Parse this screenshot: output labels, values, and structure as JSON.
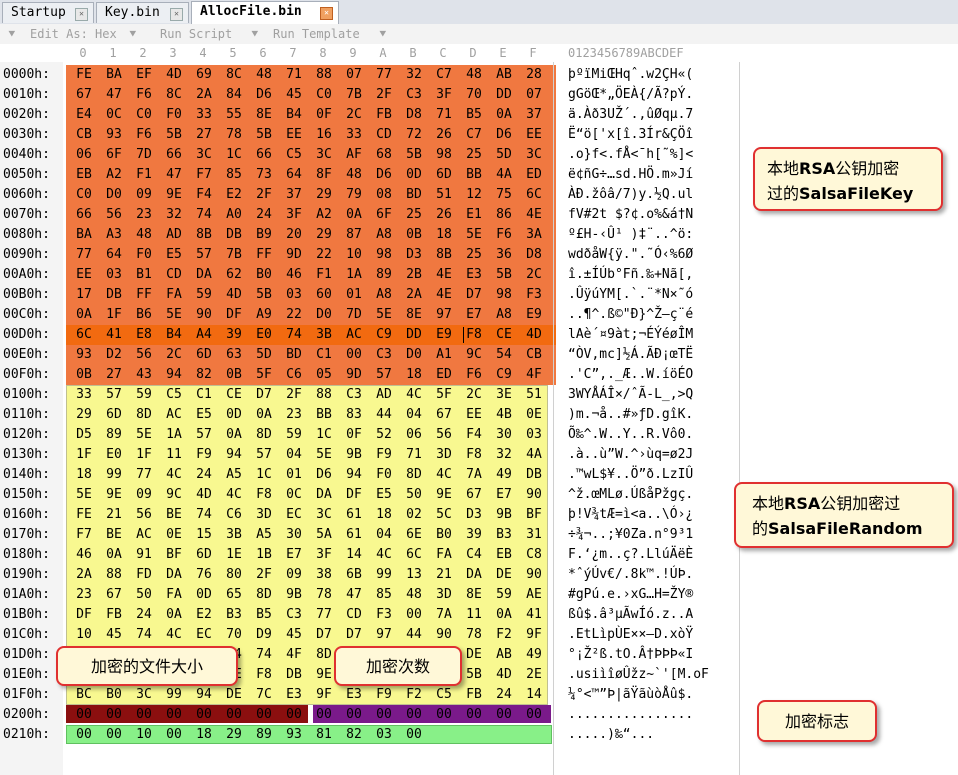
{
  "tabs": [
    {
      "label": "Startup",
      "active": false
    },
    {
      "label": "Key.bin",
      "active": false
    },
    {
      "label": "AllocFile.bin",
      "active": true
    }
  ],
  "toolbar": {
    "edit_as": "Edit As: Hex",
    "run_script": "Run Script",
    "run_template": "Run Template"
  },
  "hex_columns": [
    "0",
    "1",
    "2",
    "3",
    "4",
    "5",
    "6",
    "7",
    "8",
    "9",
    "A",
    "B",
    "C",
    "D",
    "E",
    "F"
  ],
  "ascii_header": "0123456789ABCDEF",
  "rows": [
    {
      "offset": "0000h:",
      "bytes": [
        "FE",
        "BA",
        "EF",
        "4D",
        "69",
        "8C",
        "48",
        "71",
        "88",
        "07",
        "77",
        "32",
        "C7",
        "48",
        "AB",
        "28"
      ],
      "ascii": "þºïMiŒHqˆ.w2ÇH«("
    },
    {
      "offset": "0010h:",
      "bytes": [
        "67",
        "47",
        "F6",
        "8C",
        "2A",
        "84",
        "D6",
        "45",
        "C0",
        "7B",
        "2F",
        "C3",
        "3F",
        "70",
        "DD",
        "07"
      ],
      "ascii": "gGöŒ*„ÖEÀ{/Ã?pÝ."
    },
    {
      "offset": "0020h:",
      "bytes": [
        "E4",
        "0C",
        "C0",
        "F0",
        "33",
        "55",
        "8E",
        "B4",
        "0F",
        "2C",
        "FB",
        "D8",
        "71",
        "B5",
        "0A",
        "37"
      ],
      "ascii": "ä.Àð3UŽ´.,ûØqµ.7"
    },
    {
      "offset": "0030h:",
      "bytes": [
        "CB",
        "93",
        "F6",
        "5B",
        "27",
        "78",
        "5B",
        "EE",
        "16",
        "33",
        "CD",
        "72",
        "26",
        "C7",
        "D6",
        "EE"
      ],
      "ascii": "Ë“ö['x[î.3Ír&ÇÖî"
    },
    {
      "offset": "0040h:",
      "bytes": [
        "06",
        "6F",
        "7D",
        "66",
        "3C",
        "1C",
        "66",
        "C5",
        "3C",
        "AF",
        "68",
        "5B",
        "98",
        "25",
        "5D",
        "3C"
      ],
      "ascii": ".o}f<.fÅ<¯h[˜%]<"
    },
    {
      "offset": "0050h:",
      "bytes": [
        "EB",
        "A2",
        "F1",
        "47",
        "F7",
        "85",
        "73",
        "64",
        "8F",
        "48",
        "D6",
        "0D",
        "6D",
        "BB",
        "4A",
        "ED"
      ],
      "ascii": "ë¢ñG÷…sd.HÖ.m»Jí"
    },
    {
      "offset": "0060h:",
      "bytes": [
        "C0",
        "D0",
        "09",
        "9E",
        "F4",
        "E2",
        "2F",
        "37",
        "29",
        "79",
        "08",
        "BD",
        "51",
        "12",
        "75",
        "6C"
      ],
      "ascii": "ÀÐ.žôâ/7)y.½Q.ul"
    },
    {
      "offset": "0070h:",
      "bytes": [
        "66",
        "56",
        "23",
        "32",
        "74",
        "A0",
        "24",
        "3F",
        "A2",
        "0A",
        "6F",
        "25",
        "26",
        "E1",
        "86",
        "4E"
      ],
      "ascii": "fV#2t $?¢.o%&á†N"
    },
    {
      "offset": "0080h:",
      "bytes": [
        "BA",
        "A3",
        "48",
        "AD",
        "8B",
        "DB",
        "B9",
        "20",
        "29",
        "87",
        "A8",
        "0B",
        "18",
        "5E",
        "F6",
        "3A"
      ],
      "ascii": "º£H-‹Û¹ )‡¨..^ö:"
    },
    {
      "offset": "0090h:",
      "bytes": [
        "77",
        "64",
        "F0",
        "E5",
        "57",
        "7B",
        "FF",
        "9D",
        "22",
        "10",
        "98",
        "D3",
        "8B",
        "25",
        "36",
        "D8"
      ],
      "ascii": "wdðåW{ÿ.\".˜Ó‹%6Ø"
    },
    {
      "offset": "00A0h:",
      "bytes": [
        "EE",
        "03",
        "B1",
        "CD",
        "DA",
        "62",
        "B0",
        "46",
        "F1",
        "1A",
        "89",
        "2B",
        "4E",
        "E3",
        "5B",
        "2C"
      ],
      "ascii": "î.±ÍÚb°Fñ.‰+Nã[,"
    },
    {
      "offset": "00B0h:",
      "bytes": [
        "17",
        "DB",
        "FF",
        "FA",
        "59",
        "4D",
        "5B",
        "03",
        "60",
        "01",
        "A8",
        "2A",
        "4E",
        "D7",
        "98",
        "F3"
      ],
      "ascii": ".ÛÿúYM[.`.¨*N×˜ó"
    },
    {
      "offset": "00C0h:",
      "bytes": [
        "0A",
        "1F",
        "B6",
        "5E",
        "90",
        "DF",
        "A9",
        "22",
        "D0",
        "7D",
        "5E",
        "8E",
        "97",
        "E7",
        "A8",
        "E9"
      ],
      "ascii": "..¶^.ß©\"Ð}^Ž—ç¨é"
    },
    {
      "offset": "00D0h:",
      "bytes": [
        "6C",
        "41",
        "E8",
        "B4",
        "A4",
        "39",
        "E0",
        "74",
        "3B",
        "AC",
        "C9",
        "DD",
        "E9",
        "F8",
        "CE",
        "4D"
      ],
      "ascii": "lAè´¤9àt;¬ÉÝéøÎM"
    },
    {
      "offset": "00E0h:",
      "bytes": [
        "93",
        "D2",
        "56",
        "2C",
        "6D",
        "63",
        "5D",
        "BD",
        "C1",
        "00",
        "C3",
        "D0",
        "A1",
        "9C",
        "54",
        "CB"
      ],
      "ascii": "“ÒV,mc]½Á.ÃÐ¡œTË"
    },
    {
      "offset": "00F0h:",
      "bytes": [
        "0B",
        "27",
        "43",
        "94",
        "82",
        "0B",
        "5F",
        "C6",
        "05",
        "9D",
        "57",
        "18",
        "ED",
        "F6",
        "C9",
        "4F"
      ],
      "ascii": ".'C”‚._Æ..W.íöÉO"
    },
    {
      "offset": "0100h:",
      "bytes": [
        "33",
        "57",
        "59",
        "C5",
        "C1",
        "CE",
        "D7",
        "2F",
        "88",
        "C3",
        "AD",
        "4C",
        "5F",
        "2C",
        "3E",
        "51"
      ],
      "ascii": "3WYÅÁÎ×/ˆÃ-L_,>Q"
    },
    {
      "offset": "0110h:",
      "bytes": [
        "29",
        "6D",
        "8D",
        "AC",
        "E5",
        "0D",
        "0A",
        "23",
        "BB",
        "83",
        "44",
        "04",
        "67",
        "EE",
        "4B",
        "0E"
      ],
      "ascii": ")m.¬å..#»ƒD.gîK."
    },
    {
      "offset": "0120h:",
      "bytes": [
        "D5",
        "89",
        "5E",
        "1A",
        "57",
        "0A",
        "8D",
        "59",
        "1C",
        "0F",
        "52",
        "06",
        "56",
        "F4",
        "30",
        "03"
      ],
      "ascii": "Õ‰^.W..Y..R.Vô0."
    },
    {
      "offset": "0130h:",
      "bytes": [
        "1F",
        "E0",
        "1F",
        "11",
        "F9",
        "94",
        "57",
        "04",
        "5E",
        "9B",
        "F9",
        "71",
        "3D",
        "F8",
        "32",
        "4A"
      ],
      "ascii": ".à..ù”W.^›ùq=ø2J"
    },
    {
      "offset": "0140h:",
      "bytes": [
        "18",
        "99",
        "77",
        "4C",
        "24",
        "A5",
        "1C",
        "01",
        "D6",
        "94",
        "F0",
        "8D",
        "4C",
        "7A",
        "49",
        "DB"
      ],
      "ascii": ".™wL$¥..Ö”ð.LzIÛ"
    },
    {
      "offset": "0150h:",
      "bytes": [
        "5E",
        "9E",
        "09",
        "9C",
        "4D",
        "4C",
        "F8",
        "0C",
        "DA",
        "DF",
        "E5",
        "50",
        "9E",
        "67",
        "E7",
        "90"
      ],
      "ascii": "^ž.œMLø.ÚßåPžgç."
    },
    {
      "offset": "0160h:",
      "bytes": [
        "FE",
        "21",
        "56",
        "BE",
        "74",
        "C6",
        "3D",
        "EC",
        "3C",
        "61",
        "18",
        "02",
        "5C",
        "D3",
        "9B",
        "BF"
      ],
      "ascii": "þ!V¾tÆ=ì<a..\\Ó›¿"
    },
    {
      "offset": "0170h:",
      "bytes": [
        "F7",
        "BE",
        "AC",
        "0E",
        "15",
        "3B",
        "A5",
        "30",
        "5A",
        "61",
        "04",
        "6E",
        "B0",
        "39",
        "B3",
        "31"
      ],
      "ascii": "÷¾¬..;¥0Za.n°9³1"
    },
    {
      "offset": "0180h:",
      "bytes": [
        "46",
        "0A",
        "91",
        "BF",
        "6D",
        "1E",
        "1B",
        "E7",
        "3F",
        "14",
        "4C",
        "6C",
        "FA",
        "C4",
        "EB",
        "C8"
      ],
      "ascii": "F.‘¿m..ç?.LlúÄëÈ"
    },
    {
      "offset": "0190h:",
      "bytes": [
        "2A",
        "88",
        "FD",
        "DA",
        "76",
        "80",
        "2F",
        "09",
        "38",
        "6B",
        "99",
        "13",
        "21",
        "DA",
        "DE",
        "90"
      ],
      "ascii": "*ˆýÚv€/.8k™.!ÚÞ."
    },
    {
      "offset": "01A0h:",
      "bytes": [
        "23",
        "67",
        "50",
        "FA",
        "0D",
        "65",
        "8D",
        "9B",
        "78",
        "47",
        "85",
        "48",
        "3D",
        "8E",
        "59",
        "AE"
      ],
      "ascii": "#gPú.e.›xG…H=ŽY®"
    },
    {
      "offset": "01B0h:",
      "bytes": [
        "DF",
        "FB",
        "24",
        "0A",
        "E2",
        "B3",
        "B5",
        "C3",
        "77",
        "CD",
        "F3",
        "00",
        "7A",
        "11",
        "0A",
        "41"
      ],
      "ascii": "ßû$.â³µÃwÍó.z..A"
    },
    {
      "offset": "01C0h:",
      "bytes": [
        "10",
        "45",
        "74",
        "4C",
        "EC",
        "70",
        "D9",
        "45",
        "D7",
        "D7",
        "97",
        "44",
        "90",
        "78",
        "F2",
        "9F"
      ],
      "ascii": ".EtLìpÙE××—D.xòŸ"
    },
    {
      "offset": "01D0h:",
      "bytes": [
        "B0",
        "A1",
        "8E",
        "B2",
        "DF",
        "04",
        "74",
        "4F",
        "8D",
        "C2",
        "86",
        "DE",
        "DE",
        "DE",
        "AB",
        "49"
      ],
      "ascii": "°¡Ž²ß.tO.Â†ÞÞÞ«I"
    },
    {
      "offset": "01E0h:",
      "bytes": [
        "2E",
        "75",
        "73",
        "69",
        "EC",
        "EE",
        "F8",
        "DB",
        "9E",
        "7A",
        "7E",
        "60",
        "27",
        "5B",
        "4D",
        "2E"
      ],
      "ascii": ".usiìîøÛžz~`'[M.oF"
    },
    {
      "offset": "01F0h:",
      "bytes": [
        "BC",
        "B0",
        "3C",
        "99",
        "94",
        "DE",
        "7C",
        "E3",
        "9F",
        "E3",
        "F9",
        "F2",
        "C5",
        "FB",
        "24",
        "14"
      ],
      "ascii": "¼°<™”Þ|ãŸãùòÅû$."
    },
    {
      "offset": "0200h:",
      "bytes": [
        "00",
        "00",
        "00",
        "00",
        "00",
        "00",
        "00",
        "00",
        "00",
        "00",
        "00",
        "00",
        "00",
        "00",
        "00",
        "00"
      ],
      "ascii": "................"
    },
    {
      "offset": "0210h:",
      "bytes": [
        "00",
        "00",
        "10",
        "00",
        "18",
        "29",
        "89",
        "93",
        "81",
        "82",
        "03",
        "00"
      ],
      "ascii": ".....)‰“..."
    }
  ],
  "callouts": {
    "salsa_key": {
      "prefix": "本地",
      "bold1": "RSA",
      "mid": "公钥加密",
      "line2_prefix": "过的",
      "bold2": "SalsaFileKey"
    },
    "salsa_random": {
      "prefix": "本地",
      "bold1": "RSA",
      "mid": "公钥加密过",
      "line2_prefix": "的",
      "bold2": "SalsaFileRandom"
    },
    "file_size": "加密的文件大小",
    "enc_count": "加密次数",
    "enc_flag": "加密标志"
  },
  "colors": {
    "salsa_key_band": "#f07840",
    "salsa_key_row_highlight": "#f26a10",
    "salsa_random_band": "#f8f890",
    "file_size_band": "#8b0f0f",
    "enc_count_band": "#7a1a8a",
    "enc_flag_band": "#88f088"
  }
}
